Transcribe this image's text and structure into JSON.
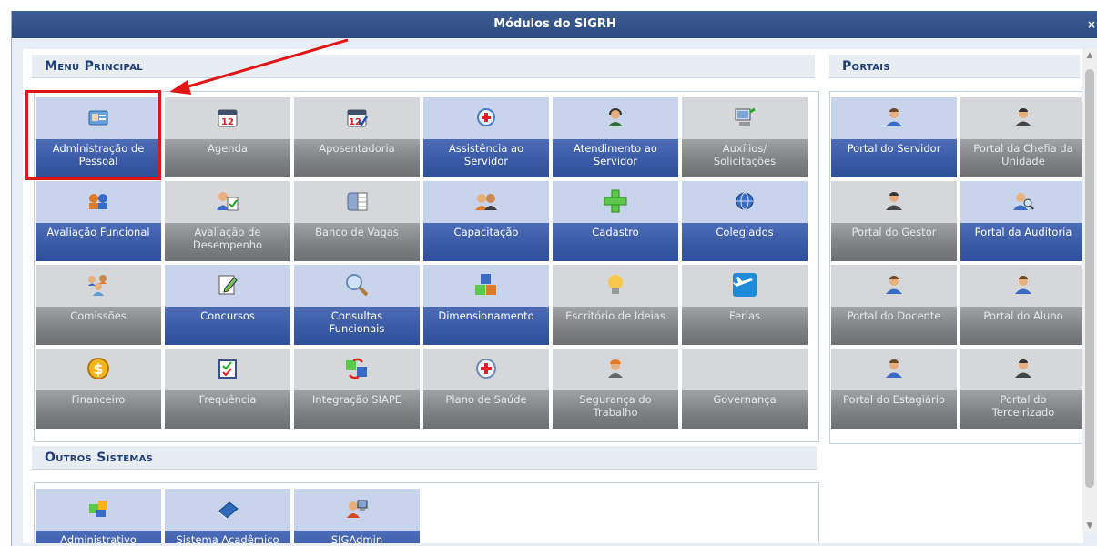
{
  "dialog": {
    "title": "Módulos do SIGRH",
    "close_label": "×"
  },
  "sections": {
    "menu_principal": "Menu Principal",
    "portais": "Portais",
    "outros_sistemas": "Outros Sistemas"
  },
  "menu_tiles": [
    {
      "label": "Administração de\nPessoal",
      "icon": "admin-pessoal-icon",
      "active": true
    },
    {
      "label": "Agenda",
      "icon": "calendar-icon",
      "active": false
    },
    {
      "label": "Aposentadoria",
      "icon": "calendar-check-icon",
      "active": false
    },
    {
      "label": "Assistência ao\nServidor",
      "icon": "assistance-icon",
      "active": true
    },
    {
      "label": "Atendimento ao\nServidor",
      "icon": "attendant-icon",
      "active": true
    },
    {
      "label": "Auxílios/\nSolicitações",
      "icon": "computer-icon",
      "active": false
    },
    {
      "label": "Avaliação Funcional",
      "icon": "people-icon",
      "active": true
    },
    {
      "label": "Avaliação de\nDesempenho",
      "icon": "evaluation-icon",
      "active": false
    },
    {
      "label": "Banco de Vagas",
      "icon": "database-icon",
      "active": false
    },
    {
      "label": "Capacitação",
      "icon": "group-icon",
      "active": true
    },
    {
      "label": "Cadastro",
      "icon": "plus-icon",
      "active": true
    },
    {
      "label": "Colegiados",
      "icon": "globe-icon",
      "active": true
    },
    {
      "label": "Comissões",
      "icon": "committee-icon",
      "active": false
    },
    {
      "label": "Concursos",
      "icon": "edit-document-icon",
      "active": true
    },
    {
      "label": "Consultas\nFuncionais",
      "icon": "magnifier-icon",
      "active": true
    },
    {
      "label": "Dimensionamento",
      "icon": "cubes-icon",
      "active": true
    },
    {
      "label": "Escritório de Ideias",
      "icon": "lightbulb-icon",
      "active": false
    },
    {
      "label": "Ferias",
      "icon": "airplane-icon",
      "active": false
    },
    {
      "label": "Financeiro",
      "icon": "dollar-coin-icon",
      "active": false
    },
    {
      "label": "Frequência",
      "icon": "checklist-icon",
      "active": false
    },
    {
      "label": "Integração SIAPE",
      "icon": "integration-icon",
      "active": false
    },
    {
      "label": "Plano de Saúde",
      "icon": "health-cross-icon",
      "active": false
    },
    {
      "label": "Segurança do\nTrabalho",
      "icon": "worker-icon",
      "active": false
    },
    {
      "label": "Governança",
      "icon": "",
      "active": false
    }
  ],
  "portal_tiles": [
    {
      "label": "Portal do Servidor",
      "icon": "user-blue-icon",
      "active": true
    },
    {
      "label": "Portal da Chefia da\nUnidade",
      "icon": "user-dark-icon",
      "active": false
    },
    {
      "label": "Portal do Gestor",
      "icon": "user-dark-icon",
      "active": false
    },
    {
      "label": "Portal da Auditoria",
      "icon": "user-search-icon",
      "active": true
    },
    {
      "label": "Portal do Docente",
      "icon": "user-blue-icon",
      "active": false
    },
    {
      "label": "Portal do Aluno",
      "icon": "user-blue-icon",
      "active": false
    },
    {
      "label": "Portal do Estagiário",
      "icon": "user-blue-icon",
      "active": false
    },
    {
      "label": "Portal do\nTerceirizado",
      "icon": "user-dark-icon",
      "active": false
    }
  ],
  "outros_tiles": [
    {
      "label": "Administrativo",
      "icon": "puzzle-icon",
      "active": true
    },
    {
      "label": "Sistema Acadêmico",
      "icon": "book-icon",
      "active": true
    },
    {
      "label": "SIGAdmin",
      "icon": "admin-user-icon",
      "active": true
    }
  ],
  "colors": {
    "title_bar": "#2d4b80",
    "accent": "#3a5aa6",
    "highlight": "#e01616"
  }
}
